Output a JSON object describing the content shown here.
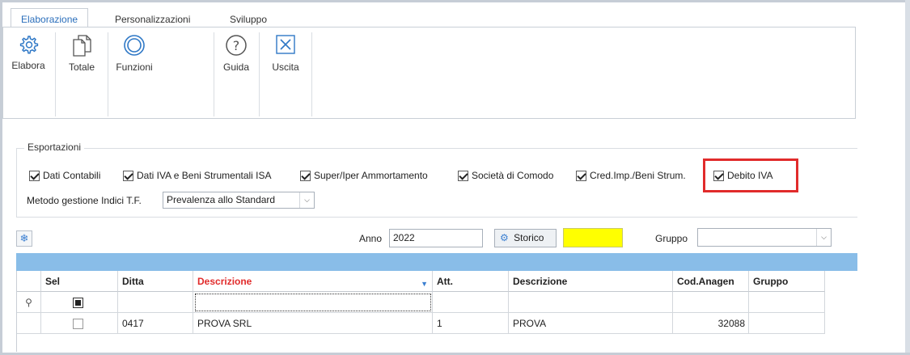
{
  "ribbon": {
    "tabs": [
      "Elaborazione",
      "Personalizzazioni",
      "Sviluppo"
    ],
    "buttons": [
      {
        "label": "Elabora",
        "icon": "gear-icon"
      },
      {
        "label": "Totale",
        "icon": "documents-icon"
      },
      {
        "label": "Funzioni",
        "icon": "ring-icon"
      },
      {
        "label": "Guida",
        "icon": "help-icon"
      },
      {
        "label": "Uscita",
        "icon": "exit-icon"
      }
    ]
  },
  "esportazioni": {
    "title": "Esportazioni",
    "checkboxes": [
      {
        "label": "Dati Contabili",
        "checked": true
      },
      {
        "label": "Dati IVA e Beni Strumentali ISA",
        "checked": true
      },
      {
        "label": "Super/Iper Ammortamento",
        "checked": true
      },
      {
        "label": "Società di Comodo",
        "checked": true
      },
      {
        "label": "Cred.Imp./Beni Strum.",
        "checked": true
      },
      {
        "label": "Debito IVA",
        "checked": true
      }
    ],
    "metodo_label": "Metodo gestione Indici T.F.",
    "metodo_value": "Prevalenza allo Standard",
    "highlight_color": "#e12b2b"
  },
  "filters": {
    "anno_label": "Anno",
    "anno_value": "2022",
    "storico_label": "Storico",
    "gruppo_label": "Gruppo",
    "gruppo_value": "",
    "yellow_color": "#ffff00"
  },
  "grid": {
    "columns": [
      "",
      "Sel",
      "Ditta",
      "Descrizione",
      "Att.",
      "Descrizione",
      "Cod.Anagen",
      "Gruppo"
    ],
    "rows": [
      {
        "ditta": "0417",
        "descrizione": "PROVA SRL",
        "att": "1",
        "descrizione2": "PROVA",
        "cod_anagen": "32088",
        "gruppo": "",
        "sel": false
      }
    ]
  }
}
